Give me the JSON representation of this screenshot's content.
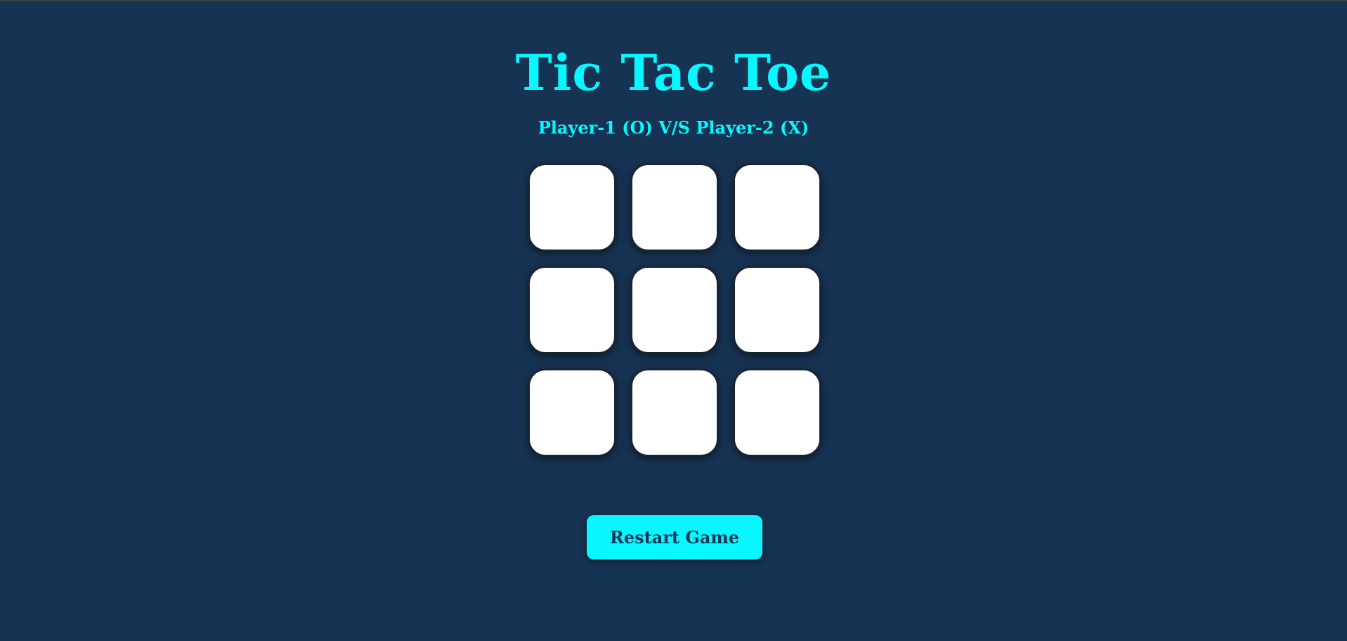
{
  "header": {
    "title": "Tic Tac Toe",
    "subtitle": "Player-1 (O) V/S Player-2 (X)"
  },
  "board": {
    "cells": [
      "",
      "",
      "",
      "",
      "",
      "",
      "",
      "",
      ""
    ]
  },
  "controls": {
    "restart_label": "Restart Game"
  },
  "colors": {
    "background": "#173353",
    "accent": "#08f7fe",
    "cell": "#ffffff"
  }
}
